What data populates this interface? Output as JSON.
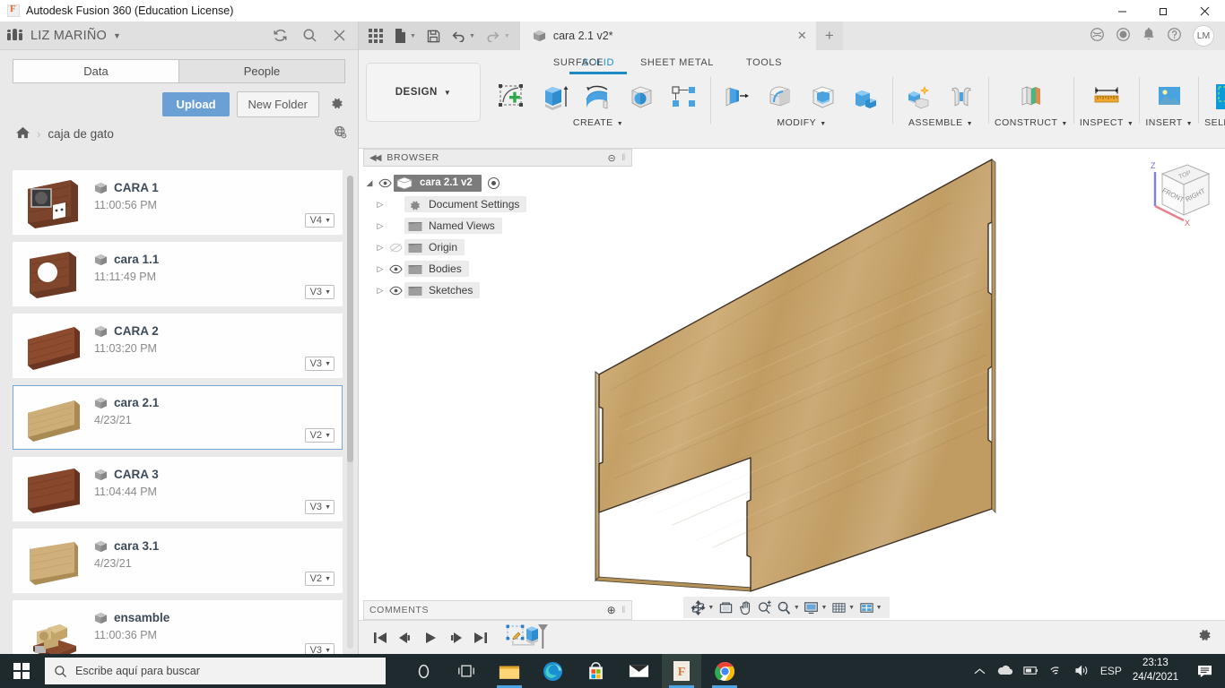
{
  "window": {
    "app_title": "Autodesk Fusion 360 (Education License)",
    "minimize": "—",
    "maximize": "❐",
    "close": "✕"
  },
  "data_panel": {
    "team_name": "LIZ MARIÑO",
    "team_caret": "▼",
    "icons": {
      "refresh": "refresh-icon",
      "search": "search-icon",
      "close": "close-icon"
    },
    "tabs": [
      {
        "label": "Data",
        "active": true
      },
      {
        "label": "People",
        "active": false
      }
    ],
    "upload_label": "Upload",
    "new_folder_label": "New Folder",
    "settings_icon": "gear-icon",
    "breadcrumb": {
      "home": "home-icon",
      "separator": "›",
      "current": "caja de gato",
      "globe": "globe-icon"
    },
    "items": [
      {
        "name": "CARA 1",
        "date": "11:00:56 PM",
        "version": "V4",
        "thumb": "cara1",
        "selected": false
      },
      {
        "name": "cara 1.1",
        "date": "11:11:49 PM",
        "version": "V3",
        "thumb": "cara11",
        "selected": false
      },
      {
        "name": "CARA 2",
        "date": "11:03:20 PM",
        "version": "V3",
        "thumb": "cara2",
        "selected": false
      },
      {
        "name": "cara 2.1",
        "date": "4/23/21",
        "version": "V2",
        "thumb": "cara21",
        "selected": true
      },
      {
        "name": "CARA 3",
        "date": "11:04:44 PM",
        "version": "V3",
        "thumb": "cara3",
        "selected": false
      },
      {
        "name": "cara 3.1",
        "date": "4/23/21",
        "version": "V2",
        "thumb": "cara31",
        "selected": false
      },
      {
        "name": "ensamble",
        "date": "11:00:36 PM",
        "version": "V3",
        "thumb": "ensamble",
        "selected": false
      }
    ]
  },
  "app_tabs": {
    "quick_access": [
      "grid-icon",
      "new-document-icon",
      "save-icon",
      "undo-icon",
      "redo-icon"
    ],
    "document": {
      "title": "cara 2.1 v2*",
      "close": "✕"
    },
    "new_tab": "+",
    "right_icons": [
      "extensions-icon",
      "job-status-icon",
      "notifications-bell-icon",
      "help-icon"
    ],
    "avatar_initials": "LM"
  },
  "ribbon": {
    "workspace": "DESIGN",
    "workspace_caret": "▼",
    "tabs": [
      {
        "label": "SOLID",
        "active": true
      },
      {
        "label": "SURFACE",
        "active": false
      },
      {
        "label": "SHEET METAL",
        "active": false
      },
      {
        "label": "TOOLS",
        "active": false
      }
    ],
    "groups": [
      {
        "label": "CREATE",
        "caret": "▼"
      },
      {
        "label": "MODIFY",
        "caret": "▼"
      },
      {
        "label": "ASSEMBLE",
        "caret": "▼"
      },
      {
        "label": "CONSTRUCT",
        "caret": "▼"
      },
      {
        "label": "INSPECT",
        "caret": "▼"
      },
      {
        "label": "INSERT",
        "caret": "▼"
      },
      {
        "label": "SELECT",
        "caret": "▼"
      }
    ]
  },
  "browser": {
    "title": "BROWSER",
    "collapse": "◀◀",
    "minus": "⊝",
    "root": "cara 2.1 v2",
    "nodes": [
      {
        "label": "Document Settings",
        "icon": "gear-icon",
        "eye": "none"
      },
      {
        "label": "Named Views",
        "icon": "folder-icon",
        "eye": "none"
      },
      {
        "label": "Origin",
        "icon": "folder-icon",
        "eye": "hidden"
      },
      {
        "label": "Bodies",
        "icon": "folder-icon",
        "eye": "visible"
      },
      {
        "label": "Sketches",
        "icon": "folder-icon",
        "eye": "visible"
      }
    ]
  },
  "comments": {
    "title": "COMMENTS",
    "add": "⊕"
  },
  "view_toolbar": {
    "items": [
      {
        "name": "orbit-icon",
        "caret": "▼"
      },
      {
        "name": "look-at-icon",
        "caret": ""
      },
      {
        "name": "pan-icon",
        "caret": ""
      },
      {
        "name": "zoom-icon",
        "caret": ""
      },
      {
        "name": "fit-icon",
        "caret": "▼"
      },
      {
        "name": "display-settings-icon",
        "caret": "▼"
      },
      {
        "name": "grid-snap-icon",
        "caret": "▼"
      },
      {
        "name": "viewports-icon",
        "caret": "▼"
      }
    ]
  },
  "viewcube": {
    "faces": {
      "top": "TOP",
      "front": "FRONT",
      "right": "RIGHT"
    },
    "axes": {
      "z": "Z",
      "x": "X"
    }
  },
  "timeline": {
    "buttons": [
      "go-to-beginning-icon",
      "step-back-icon",
      "play-icon",
      "step-forward-icon",
      "go-to-end-icon"
    ],
    "features": [
      "sketch-feature-icon",
      "extrude-feature-icon"
    ],
    "settings": "gear-icon"
  },
  "taskbar": {
    "start": "windows-start-icon",
    "search_placeholder": "Escribe aquí para buscar",
    "apps": [
      "cortana-icon",
      "task-view-icon",
      "file-explorer-icon",
      "edge-icon",
      "microsoft-store-icon",
      "mail-icon",
      "fusion360-icon",
      "chrome-icon"
    ],
    "tray": [
      "show-hidden-icons-chevron",
      "onedrive-icon",
      "battery-icon",
      "wifi-icon",
      "volume-icon"
    ],
    "language": "ESP",
    "time": "23:13",
    "date": "24/4/2021",
    "notifications": "action-center-icon"
  },
  "colors": {
    "accent_blue": "#1d8ac6",
    "upload_blue": "#6ba0d4",
    "selection_blue": "#7ba7d7",
    "wood_light": "#c8a568",
    "panel_bg": "#f0f0f0",
    "taskbar_bg": "#1f2a2e"
  }
}
